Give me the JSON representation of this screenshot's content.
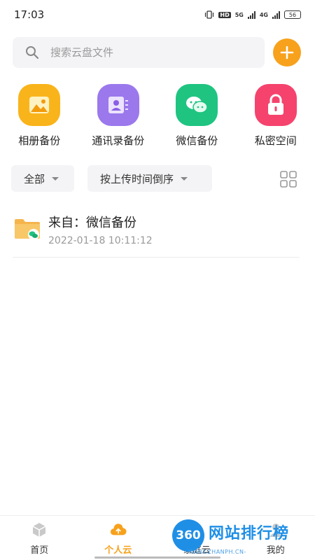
{
  "status_bar": {
    "time": "17:03",
    "signal1": "5G",
    "signal2": "4G",
    "battery": "56",
    "hd_label": "HD"
  },
  "search": {
    "placeholder": "搜索云盘文件"
  },
  "backups": [
    {
      "label": "相册备份",
      "icon": "photo-album-icon",
      "color": "#f9b41b"
    },
    {
      "label": "通讯录备份",
      "icon": "contacts-icon",
      "color": "#9b78ec"
    },
    {
      "label": "微信备份",
      "icon": "wechat-icon",
      "color": "#1fc481"
    },
    {
      "label": "私密空间",
      "icon": "lock-icon",
      "color": "#f5436d"
    }
  ],
  "filters": {
    "scope": "全部",
    "sort": "按上传时间倒序"
  },
  "files": [
    {
      "name": "来自：微信备份",
      "date": "2022-01-18 10:11:12",
      "icon": "wechat-folder-icon"
    }
  ],
  "nav": {
    "items": [
      {
        "label": "首页",
        "icon": "home-cube-icon"
      },
      {
        "label": "个人云",
        "icon": "personal-cloud-icon",
        "active": true
      },
      {
        "label": "家庭云",
        "icon": "family-cloud-icon"
      },
      {
        "label": "我的",
        "icon": "profile-icon"
      }
    ]
  },
  "watermark": {
    "logo": "360",
    "text": "网站排行榜",
    "sub": "-WANGZHANPH.CN-"
  },
  "colors": {
    "accent": "#f7a11c",
    "watermark": "#1f8fe6"
  }
}
